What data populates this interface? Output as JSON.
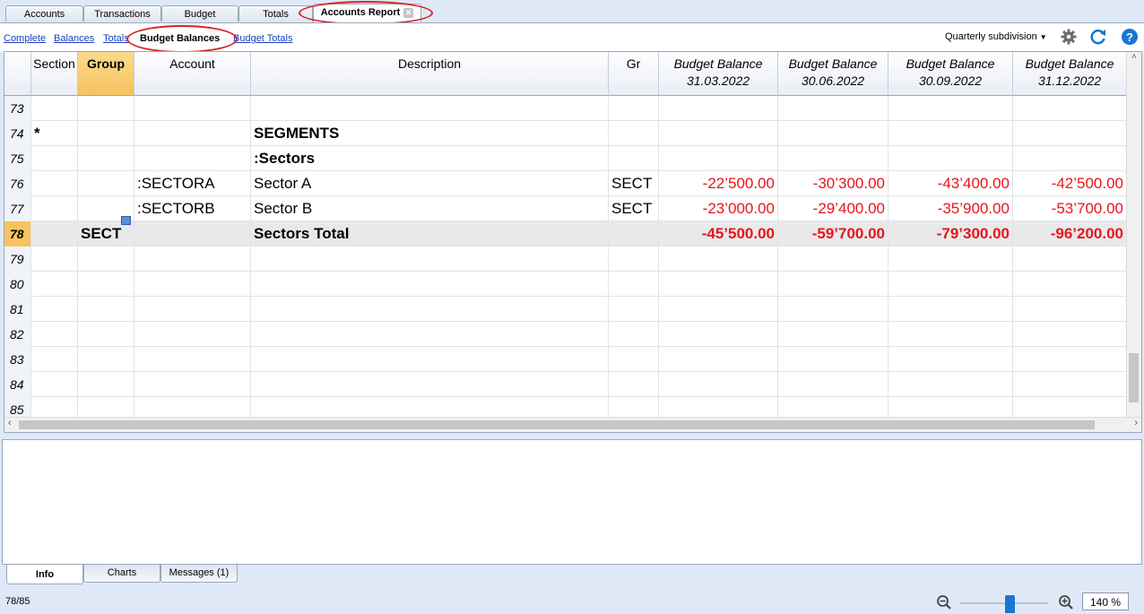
{
  "top_tabs": [
    "Accounts",
    "Transactions",
    "Budget",
    "Totals",
    "Accounts Report"
  ],
  "sub_links": [
    "Complete",
    "Balances",
    "Totals",
    "Budget Balances",
    "Budget Totals"
  ],
  "subdivision": "Quarterly subdivision",
  "columns": {
    "section": "Section",
    "group": "Group",
    "account": "Account",
    "description": "Description",
    "gr": "Gr",
    "b1_title": "Budget Balance",
    "b1_date": "31.03.2022",
    "b2_title": "Budget Balance",
    "b2_date": "30.06.2022",
    "b3_title": "Budget Balance",
    "b3_date": "30.09.2022",
    "b4_title": "Budget Balance",
    "b4_date": "31.12.2022"
  },
  "rows": [
    {
      "n": "73",
      "section": "",
      "group": "",
      "account": "",
      "description": "",
      "gr": "",
      "v1": "",
      "v2": "",
      "v3": "",
      "v4": ""
    },
    {
      "n": "74",
      "section": "*",
      "group": "",
      "account": "",
      "description": "SEGMENTS",
      "gr": "",
      "v1": "",
      "v2": "",
      "v3": "",
      "v4": ""
    },
    {
      "n": "75",
      "section": "",
      "group": "",
      "account": "",
      "description": ":Sectors",
      "gr": "",
      "v1": "",
      "v2": "",
      "v3": "",
      "v4": ""
    },
    {
      "n": "76",
      "section": "",
      "group": "",
      "account": ":SECTORA",
      "description": "Sector A",
      "gr": "SECT",
      "v1": "-22’500.00",
      "v2": "-30’300.00",
      "v3": "-43’400.00",
      "v4": "-42’500.00"
    },
    {
      "n": "77",
      "section": "",
      "group": "",
      "account": ":SECTORB",
      "description": "Sector B",
      "gr": "SECT",
      "v1": "-23’000.00",
      "v2": "-29’400.00",
      "v3": "-35’900.00",
      "v4": "-53’700.00"
    },
    {
      "n": "78",
      "section": "",
      "group": "SECT",
      "account": "",
      "description": "Sectors Total",
      "gr": "",
      "v1": "-45’500.00",
      "v2": "-59’700.00",
      "v3": "-79’300.00",
      "v4": "-96’200.00"
    },
    {
      "n": "79",
      "section": "",
      "group": "",
      "account": "",
      "description": "",
      "gr": "",
      "v1": "",
      "v2": "",
      "v3": "",
      "v4": ""
    },
    {
      "n": "80",
      "section": "",
      "group": "",
      "account": "",
      "description": "",
      "gr": "",
      "v1": "",
      "v2": "",
      "v3": "",
      "v4": ""
    },
    {
      "n": "81",
      "section": "",
      "group": "",
      "account": "",
      "description": "",
      "gr": "",
      "v1": "",
      "v2": "",
      "v3": "",
      "v4": ""
    },
    {
      "n": "82",
      "section": "",
      "group": "",
      "account": "",
      "description": "",
      "gr": "",
      "v1": "",
      "v2": "",
      "v3": "",
      "v4": ""
    },
    {
      "n": "83",
      "section": "",
      "group": "",
      "account": "",
      "description": "",
      "gr": "",
      "v1": "",
      "v2": "",
      "v3": "",
      "v4": ""
    },
    {
      "n": "84",
      "section": "",
      "group": "",
      "account": "",
      "description": "",
      "gr": "",
      "v1": "",
      "v2": "",
      "v3": "",
      "v4": ""
    },
    {
      "n": "85",
      "section": "",
      "group": "",
      "account": "",
      "description": "",
      "gr": "",
      "v1": "",
      "v2": "",
      "v3": "",
      "v4": ""
    }
  ],
  "bottom_tabs": [
    "Info",
    "Charts",
    "Messages (1)"
  ],
  "status": "78/85",
  "zoom": "140 %",
  "icons": {
    "settings": "gear-icon",
    "refresh": "refresh-icon",
    "help": "help-icon",
    "zoom_out": "zoom-out-icon",
    "zoom_in": "zoom-in-icon"
  },
  "colors": {
    "negative": "#e8141b",
    "highlight": "#f6c35e",
    "annotation": "#d42525"
  }
}
